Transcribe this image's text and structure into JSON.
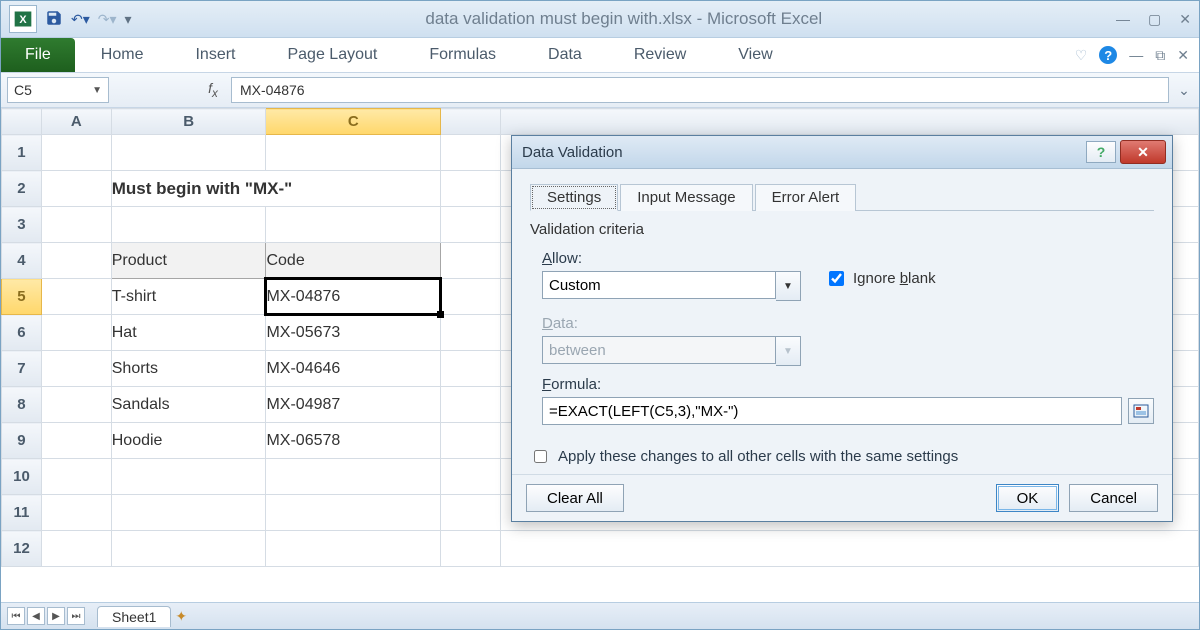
{
  "window": {
    "title": "data validation must begin with.xlsx - Microsoft Excel"
  },
  "ribbon": {
    "tabs": [
      "File",
      "Home",
      "Insert",
      "Page Layout",
      "Formulas",
      "Data",
      "Review",
      "View"
    ]
  },
  "formula_bar": {
    "cell_ref": "C5",
    "value": "MX-04876"
  },
  "grid": {
    "cols": [
      "A",
      "B",
      "C"
    ],
    "row_nums": [
      "1",
      "2",
      "3",
      "4",
      "5",
      "6",
      "7",
      "8",
      "9",
      "10",
      "11",
      "12"
    ],
    "title": "Must begin with \"MX-\"",
    "headers": [
      "Product",
      "Code"
    ],
    "rows": [
      [
        "T-shirt",
        "MX-04876"
      ],
      [
        "Hat",
        "MX-05673"
      ],
      [
        "Shorts",
        "MX-04646"
      ],
      [
        "Sandals",
        "MX-04987"
      ],
      [
        "Hoodie",
        "MX-06578"
      ]
    ]
  },
  "sheet_tabs": [
    "Sheet1"
  ],
  "dialog": {
    "title": "Data Validation",
    "tabs": [
      "Settings",
      "Input Message",
      "Error Alert"
    ],
    "criteria_label": "Validation criteria",
    "allow_label": "llow:",
    "allow_value": "Custom",
    "ignore_blank_checked": true,
    "data_label": "ata:",
    "data_value": "between",
    "formula_label": "ormula:",
    "formula_value": "=EXACT(LEFT(C5,3),\"MX-\")",
    "apply_label": "Apply these changes to all other cells with the same settings",
    "buttons": [
      "Clear All",
      "OK",
      "Cancel"
    ]
  }
}
